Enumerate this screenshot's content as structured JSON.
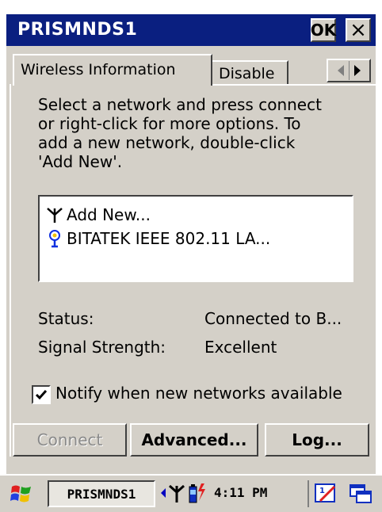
{
  "window": {
    "title": "PRISMNDS1",
    "ok_label": "OK",
    "close_label": "×"
  },
  "tabs": [
    {
      "label": "Wireless Information",
      "active": true
    },
    {
      "label": "Disable",
      "active": false
    }
  ],
  "instructions": [
    "Select a network and press connect",
    "or right-click for more options.  To",
    "add a new network, double-click",
    "'Add New'."
  ],
  "networks": [
    {
      "label": "Add New...",
      "icon": "antenna-icon"
    },
    {
      "label": "BITATEK IEEE 802.11 LA...",
      "icon": "network-connected-icon"
    }
  ],
  "status": {
    "status_label": "Status:",
    "status_value": "Connected to B...",
    "signal_label": "Signal Strength:",
    "signal_value": "Excellent"
  },
  "notify": {
    "label": "Notify when new networks available",
    "checked": true
  },
  "buttons": {
    "connect": "Connect",
    "advanced": "Advanced...",
    "log": "Log..."
  },
  "taskbar": {
    "active_task": "PRISMNDS1",
    "time": "4:11 PM"
  },
  "colors": {
    "titlebar": "#0a1f80",
    "dialog": "#d4d0c8"
  }
}
